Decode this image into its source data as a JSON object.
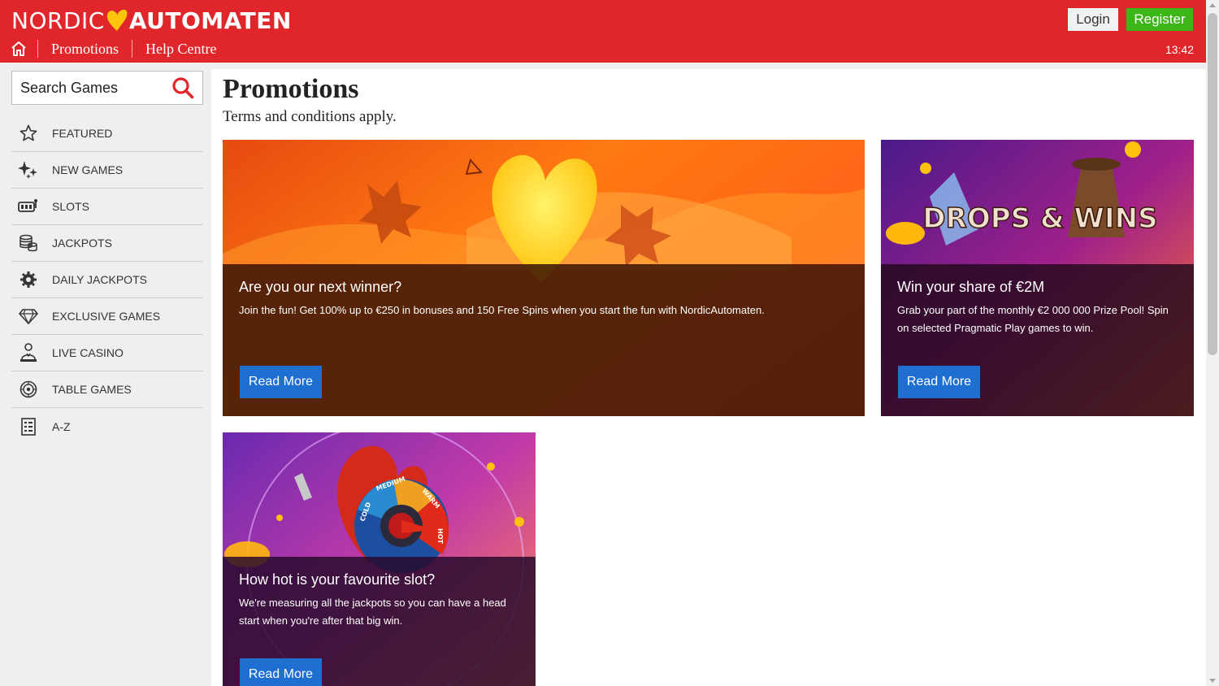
{
  "header": {
    "logo_left": "NORDIC",
    "logo_right": "AUTOMATEN",
    "nav": [
      {
        "label": "Promotions"
      },
      {
        "label": "Help Centre"
      }
    ],
    "login_label": "Login",
    "register_label": "Register",
    "time": "13:42"
  },
  "sidebar": {
    "search_label": "Search Games",
    "items": [
      {
        "label": "FEATURED",
        "icon": "star-icon"
      },
      {
        "label": "NEW GAMES",
        "icon": "sparkles-icon"
      },
      {
        "label": "SLOTS",
        "icon": "slot-machine-icon"
      },
      {
        "label": "JACKPOTS",
        "icon": "coins-icon"
      },
      {
        "label": "DAILY JACKPOTS",
        "icon": "gear-coin-icon"
      },
      {
        "label": "EXCLUSIVE GAMES",
        "icon": "diamond-icon"
      },
      {
        "label": "LIVE CASINO",
        "icon": "dealer-icon"
      },
      {
        "label": "TABLE GAMES",
        "icon": "roulette-icon"
      },
      {
        "label": "A-Z",
        "icon": "list-icon"
      }
    ]
  },
  "main": {
    "title": "Promotions",
    "subtitle": "Terms and conditions apply.",
    "cards": [
      {
        "title": "Are you our next winner?",
        "description": "Join the fun! Get 100% up to €250 in bonuses and 150 Free Spins when you start the fun with NordicAutomaten.",
        "button": "Read More",
        "art_text": ""
      },
      {
        "title": "Win your share of €2M",
        "description": "Grab your part of the monthly €2 000 000 Prize Pool! Spin on selected Pragmatic Play games to win.",
        "button": "Read More",
        "art_text": "DROPS & WINS"
      },
      {
        "title": "How hot is your favourite slot?",
        "description": "We're measuring all the jackpots so you can have a head start when you're after that big win.",
        "button": "Read More",
        "art_labels": [
          "COLD",
          "MEDIUM",
          "WARM",
          "HOT"
        ]
      }
    ]
  },
  "colors": {
    "brand_red": "#e0262b",
    "register_green": "#3cb516",
    "button_blue": "#1f6fd1",
    "heart_yellow": "#ffc40c"
  }
}
